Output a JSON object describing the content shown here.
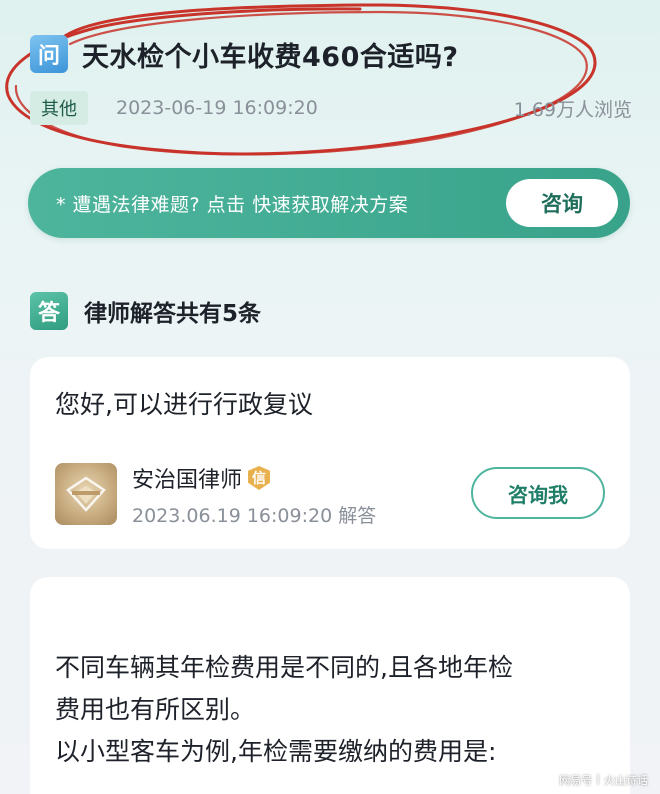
{
  "question": {
    "badge": "问",
    "title": "天水检个小车收费460合适吗?",
    "tag": "其他",
    "date": "2023-06-19 16:09:20",
    "views": "1.69万人浏览"
  },
  "consult_banner": {
    "text": "* 遭遇法律难题? 点击 快速获取解决方案",
    "button": "咨询"
  },
  "answers": {
    "badge": "答",
    "title": "律师解答共有5条",
    "items": [
      {
        "text": "您好,可以进行行政复议",
        "lawyer": "安治国律师",
        "cert": "信",
        "time": "2023.06.19 16:09:20 解答",
        "button": "咨询我"
      }
    ],
    "second": {
      "lines": [
        "不同车辆其年检费用是不同的,且各地年检",
        "费用也有所区别。",
        "以小型客车为例,年检需要缴纳的费用是:"
      ]
    }
  },
  "watermark": {
    "source": "网易号",
    "author": "火山诗话"
  },
  "colors": {
    "brand_green": "#3fa98f",
    "annotation_red": "#c8332a",
    "question_blue": "#3b94d8"
  }
}
